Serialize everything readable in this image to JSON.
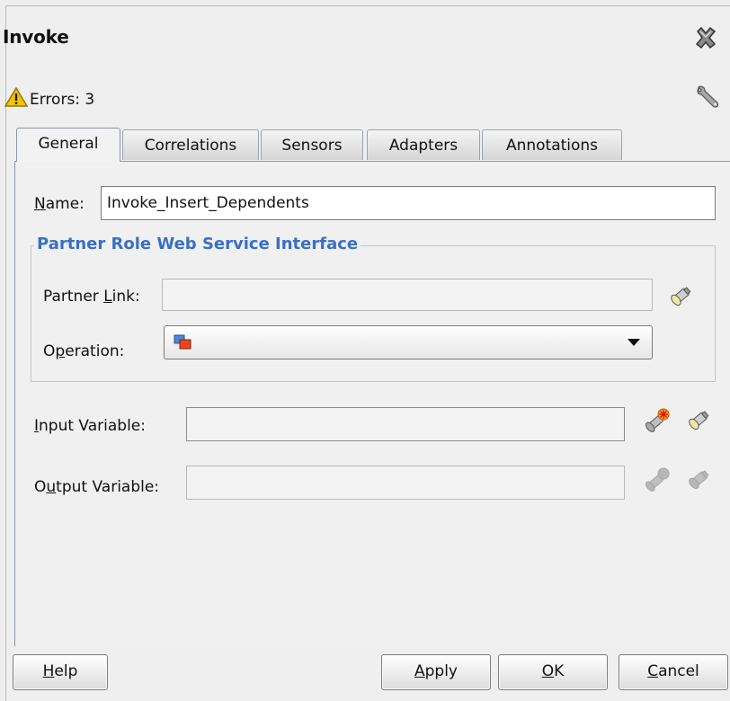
{
  "dialog": {
    "title": "Invoke",
    "errors_text": "Errors: 3"
  },
  "tabs": [
    {
      "label": "General",
      "active": true
    },
    {
      "label": "Correlations",
      "active": false
    },
    {
      "label": "Sensors",
      "active": false
    },
    {
      "label": "Adapters",
      "active": false
    },
    {
      "label": "Annotations",
      "active": false
    }
  ],
  "general": {
    "name_label_mnemonic": "N",
    "name_label_rest": "ame:",
    "name_value": "Invoke_Insert_Dependents",
    "group_title": "Partner Role Web Service Interface",
    "partner_link_label_pre": "Partner ",
    "partner_link_label_mnemonic": "L",
    "partner_link_label_post": "ink:",
    "partner_link_value": "",
    "operation_label_pre": "O",
    "operation_label_mnemonic": "p",
    "operation_label_post": "eration:",
    "operation_value": "",
    "input_label_mnemonic": "I",
    "input_label_rest": "nput Variable:",
    "input_value": "",
    "output_label_pre": "O",
    "output_label_mnemonic": "u",
    "output_label_post": "tput Variable:",
    "output_value": ""
  },
  "buttons": {
    "help_mnemonic": "H",
    "help_rest": "elp",
    "apply_mnemonic": "A",
    "apply_rest": "pply",
    "ok_mnemonic": "O",
    "ok_rest": "K",
    "cancel_mnemonic": "C",
    "cancel_rest": "ancel"
  },
  "icons": {
    "close": "close-icon",
    "warning": "warning-icon",
    "wrench": "wrench-icon",
    "browse": "flashlight-icon",
    "create_variable": "create-variable-icon",
    "operation": "operation-icon"
  },
  "colors": {
    "group_title": "#3a6fc4",
    "warning": "#f5c400"
  }
}
